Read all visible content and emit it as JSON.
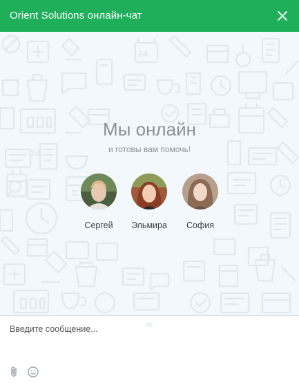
{
  "header": {
    "title": "Orient Solutions онлайн-чат"
  },
  "welcome": {
    "heading": "Мы онлайн",
    "subheading": "и готовы вам помочь!"
  },
  "operators": [
    {
      "name": "Сергей"
    },
    {
      "name": "Эльмира"
    },
    {
      "name": "София"
    }
  ],
  "composer": {
    "placeholder": "Введите сообщение..."
  },
  "icons": {
    "close": "close-icon",
    "attach": "paperclip-icon",
    "emoji": "smiley-icon"
  },
  "colors": {
    "header_bg": "#1fae5a",
    "header_text": "#ffffff",
    "body_bg": "#f2f8fb",
    "muted_text": "#8b9196"
  }
}
